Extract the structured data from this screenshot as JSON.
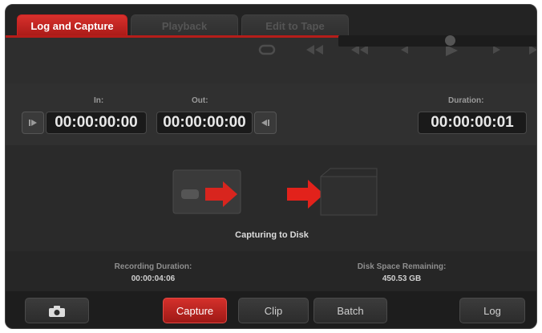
{
  "tabs": [
    {
      "label": "Log and Capture",
      "active": true
    },
    {
      "label": "Playback",
      "active": false
    },
    {
      "label": "Edit to Tape",
      "active": false
    }
  ],
  "transport": {
    "icons": [
      "loop-icon",
      "rewind-to-start-icon",
      "rewind-icon",
      "step-back-icon",
      "play-icon",
      "step-forward-icon",
      "fast-forward-icon"
    ]
  },
  "timecode": {
    "in_label": "In:",
    "in_value": "00:00:00:00",
    "out_label": "Out:",
    "out_value": "00:00:00:00",
    "duration_label": "Duration:",
    "duration_value": "00:00:00:01"
  },
  "status": {
    "text": "Capturing to Disk"
  },
  "info": {
    "recording_label": "Recording Duration:",
    "recording_value": "00:00:04:06",
    "disk_label": "Disk Space Remaining:",
    "disk_value": "450.53 GB"
  },
  "bottom": {
    "capture": "Capture",
    "clip": "Clip",
    "batch": "Batch",
    "log": "Log"
  },
  "colors": {
    "accent": "#c2211d"
  }
}
